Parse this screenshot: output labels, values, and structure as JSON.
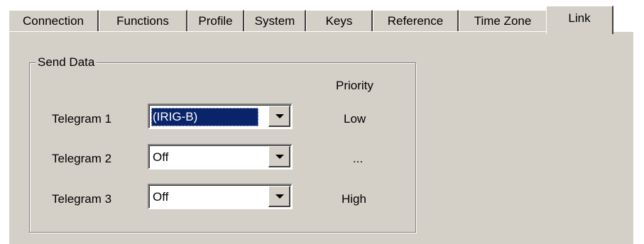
{
  "tabs": [
    {
      "label": "Connection"
    },
    {
      "label": "Functions"
    },
    {
      "label": "Profile"
    },
    {
      "label": "System"
    },
    {
      "label": "Keys"
    },
    {
      "label": "Reference"
    },
    {
      "label": "Time Zone"
    },
    {
      "label": "Link"
    }
  ],
  "active_tab": "Link",
  "send_data": {
    "title": "Send Data",
    "priority_header": "Priority",
    "telegrams": [
      {
        "label": "Telegram 1",
        "value": "(IRIG-B)",
        "priority": "Low"
      },
      {
        "label": "Telegram 2",
        "value": "Off",
        "priority": "..."
      },
      {
        "label": "Telegram 3",
        "value": "Off",
        "priority": "High"
      }
    ]
  },
  "icons": {
    "dropdown": "chevron-down-icon"
  },
  "colors": {
    "panel": "#d4d0c8",
    "selection": "#0a246a",
    "selection_text": "#ffffff"
  }
}
